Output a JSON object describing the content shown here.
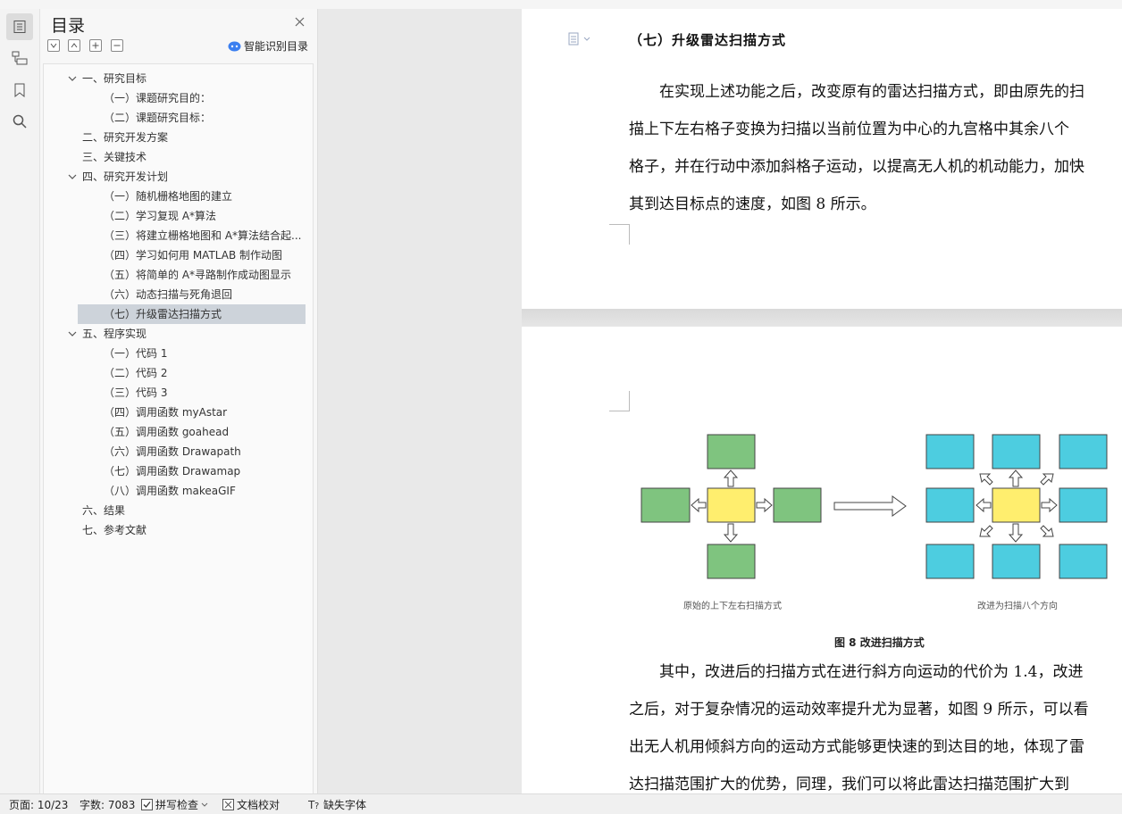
{
  "sidebar": {
    "title": "目录",
    "smart_label": "智能识别目录",
    "items": [
      {
        "label": "一、研究目标",
        "level": 1,
        "expanded": true
      },
      {
        "label": "（一）课题研究目的：",
        "level": 2
      },
      {
        "label": "（二）课题研究目标：",
        "level": 2
      },
      {
        "label": "二、研究开发方案",
        "level": 1
      },
      {
        "label": "三、关键技术",
        "level": 1
      },
      {
        "label": "四、研究开发计划",
        "level": 1,
        "expanded": true
      },
      {
        "label": "（一）随机栅格地图的建立",
        "level": 2
      },
      {
        "label": "（二）学习复现 A*算法",
        "level": 2
      },
      {
        "label": "（三）将建立栅格地图和 A*算法结合起...",
        "level": 2
      },
      {
        "label": "（四）学习如何用 MATLAB 制作动图",
        "level": 2
      },
      {
        "label": "（五）将简单的 A*寻路制作成动图显示",
        "level": 2
      },
      {
        "label": "（六）动态扫描与死角退回",
        "level": 2
      },
      {
        "label": "（七）升级雷达扫描方式",
        "level": 2,
        "selected": true
      },
      {
        "label": "五、程序实现",
        "level": 1,
        "expanded": true
      },
      {
        "label": "（一）代码 1",
        "level": 2
      },
      {
        "label": "（二）代码 2",
        "level": 2
      },
      {
        "label": "（三）代码 3",
        "level": 2
      },
      {
        "label": "（四）调用函数 myAstar",
        "level": 2
      },
      {
        "label": "（五）调用函数 goahead",
        "level": 2
      },
      {
        "label": "（六）调用函数 Drawapath",
        "level": 2
      },
      {
        "label": "（七）调用函数 Drawamap",
        "level": 2
      },
      {
        "label": "（八）调用函数 makeaGIF",
        "level": 2
      },
      {
        "label": "六、结果",
        "level": 1
      },
      {
        "label": "七、参考文献",
        "level": 1
      }
    ]
  },
  "document": {
    "heading": "（七）升级雷达扫描方式",
    "para1": [
      "　　在实现上述功能之后，改变原有的雷达扫描方式，即由原先的扫",
      "描上下左右格子变换为扫描以当前位置为中心的九宫格中其余八个",
      "格子，并在行动中添加斜格子运动，以提高无人机的机动能力，加快",
      "其到达目标点的速度，如图 8 所示。"
    ],
    "figure": {
      "left_label": "原始的上下左右扫描方式",
      "right_label": "改进为扫描八个方向",
      "caption": "图 8  改进扫描方式"
    },
    "para2": [
      "　　其中，改进后的扫描方式在进行斜方向运动的代价为 1.4，改进",
      "之后，对于复杂情况的运动效率提升尤为显著，如图 9 所示，可以看",
      "出无人机用倾斜方向的运动方式能够更快速的到达目的地，体现了雷",
      "达扫描范围扩大的优势，同理，我们可以将此雷达扫描范围扩大到"
    ]
  },
  "statusbar": {
    "page": "页面: 10/23",
    "words": "字数: 7083",
    "spell": "拼写检查",
    "proof": "文档校对",
    "missing_font": "缺失字体"
  },
  "colors": {
    "green": "#7fc47f",
    "yellow": "#ffee6e",
    "cyan": "#4dcde0",
    "selected_row": "#cdd3da",
    "smart_icon": "#3b7ff0"
  }
}
